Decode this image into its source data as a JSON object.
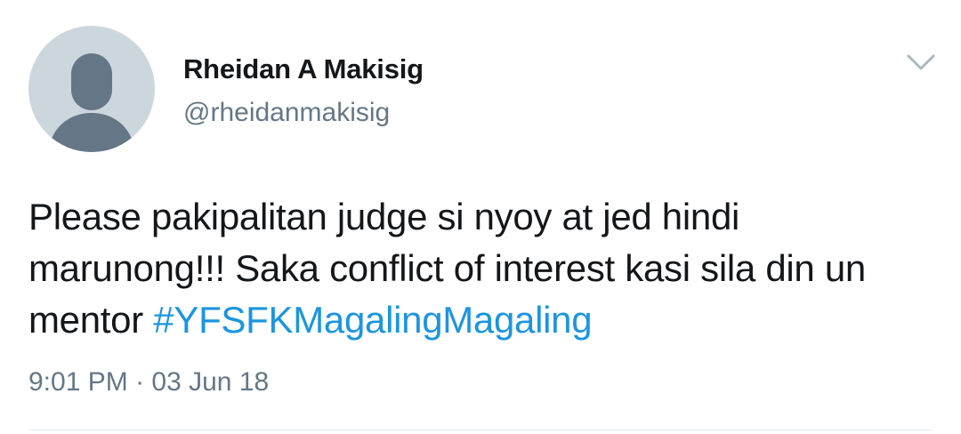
{
  "tweet": {
    "author": {
      "name": "Rheidan A Makisig",
      "handle": "@rheidanmakisig",
      "avatar_icon": "default-profile-icon"
    },
    "menu_icon": "chevron-down-icon",
    "text": "Please pakipalitan judge si nyoy at jed hindi marunong!!! Saka conflict of interest kasi sila din un mentor ",
    "hashtag": "#YFSFKMagalingMagaling",
    "time": "9:01 PM",
    "separator": " · ",
    "date": "03 Jun 18"
  },
  "colors": {
    "hashtag": "#1b95e0",
    "secondary_text": "#657786",
    "avatar_bg": "#ccd6dd",
    "avatar_fg": "#657786"
  }
}
